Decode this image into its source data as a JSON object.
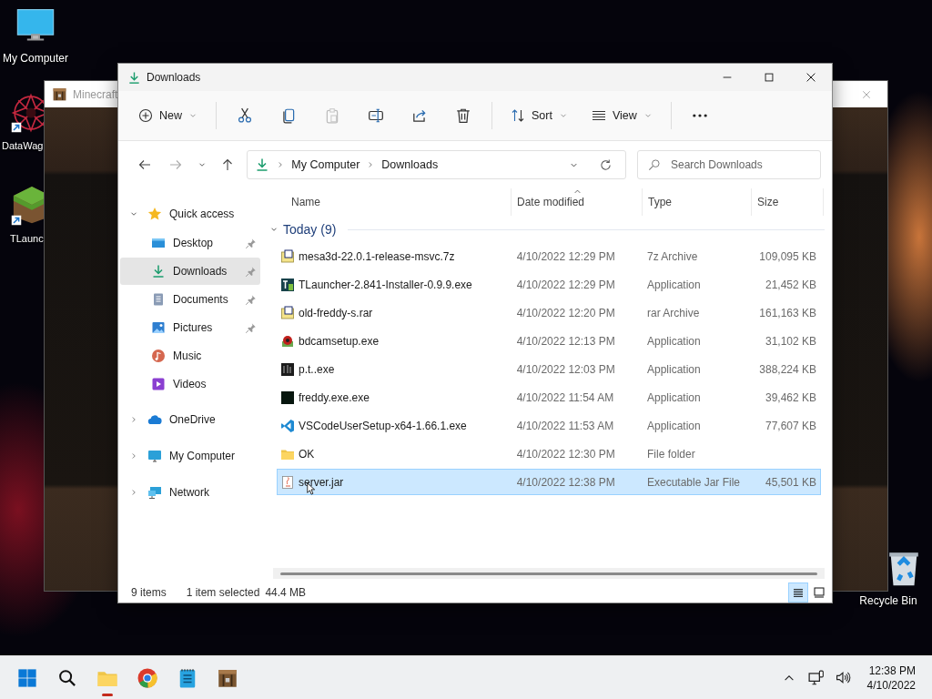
{
  "desktop_icons": [
    {
      "label": "My Computer",
      "kind": "computer",
      "shortcut": false
    },
    {
      "label": "DataWag",
      "kind": "datawag",
      "shortcut": true
    },
    {
      "label": "TLaunc",
      "kind": "grass",
      "shortcut": true
    },
    {
      "label": "Recycle Bin",
      "kind": "recycle",
      "shortcut": false
    }
  ],
  "background_window": {
    "title": "Minecraft"
  },
  "window": {
    "title": "Downloads"
  },
  "toolbar": [
    [
      {
        "kind": "new",
        "label": "New"
      }
    ],
    [
      {
        "kind": "cut",
        "disabled": false
      },
      {
        "kind": "copy",
        "disabled": false
      },
      {
        "kind": "paste",
        "disabled": true
      },
      {
        "kind": "rename",
        "disabled": false
      },
      {
        "kind": "share",
        "disabled": false
      },
      {
        "kind": "delete",
        "disabled": false
      }
    ],
    [
      {
        "kind": "sort",
        "label": "Sort"
      },
      {
        "kind": "view",
        "label": "View"
      }
    ],
    [
      {
        "kind": "more",
        "disabled": false
      }
    ]
  ],
  "navigation": {
    "back_disabled": false,
    "forward_disabled": true
  },
  "address_bar": {
    "path": [
      "My Computer",
      "Downloads"
    ]
  },
  "search": {
    "placeholder": "Search Downloads"
  },
  "sidebar": {
    "items": [
      {
        "label": "Quick access",
        "kind": "star",
        "selected": false,
        "expanded": true,
        "children": [
          {
            "label": "Desktop",
            "kind": "desktop",
            "selected": false,
            "pinned": true
          },
          {
            "label": "Downloads",
            "kind": "download",
            "selected": true,
            "pinned": true
          },
          {
            "label": "Documents",
            "kind": "document",
            "selected": false,
            "pinned": true
          },
          {
            "label": "Pictures",
            "kind": "picture",
            "selected": false,
            "pinned": true
          },
          {
            "label": "Music",
            "kind": "music",
            "selected": false,
            "pinned": false
          },
          {
            "label": "Videos",
            "kind": "video",
            "selected": false,
            "pinned": false
          }
        ]
      },
      {
        "label": "OneDrive",
        "kind": "cloud",
        "selected": false,
        "expanded": false
      },
      {
        "label": "My Computer",
        "kind": "monitor",
        "selected": false,
        "expanded": false
      },
      {
        "label": "Network",
        "kind": "network",
        "selected": false,
        "expanded": false
      }
    ]
  },
  "file_list": {
    "columns": [
      {
        "label": "Name",
        "sorted": false
      },
      {
        "label": "Date modified",
        "sorted": true
      },
      {
        "label": "Type",
        "sorted": false
      },
      {
        "label": "Size",
        "sorted": false
      }
    ],
    "groups": [
      {
        "label": "Today (9)",
        "expanded": true,
        "rows": [
          {
            "name": "mesa3d-22.0.1-release-msvc.7z",
            "kind": "archive",
            "date": "4/10/2022 12:29 PM",
            "type": "7z Archive",
            "size": "109,095 KB",
            "selected": false
          },
          {
            "name": "TLauncher-2.841-Installer-0.9.9.exe",
            "kind": "app-teal",
            "date": "4/10/2022 12:29 PM",
            "type": "Application",
            "size": "21,452 KB",
            "selected": false
          },
          {
            "name": "old-freddy-s.rar",
            "kind": "archive",
            "date": "4/10/2022 12:20 PM",
            "type": "rar Archive",
            "size": "161,163 KB",
            "selected": false
          },
          {
            "name": "bdcamsetup.exe",
            "kind": "app-red",
            "date": "4/10/2022 12:13 PM",
            "type": "Application",
            "size": "31,102 KB",
            "selected": false
          },
          {
            "name": "p.t..exe",
            "kind": "app-dark",
            "date": "4/10/2022 12:03 PM",
            "type": "Application",
            "size": "388,224 KB",
            "selected": false
          },
          {
            "name": "freddy.exe.exe",
            "kind": "app-black",
            "date": "4/10/2022 11:54 AM",
            "type": "Application",
            "size": "39,462 KB",
            "selected": false
          },
          {
            "name": "VSCodeUserSetup-x64-1.66.1.exe",
            "kind": "vscode",
            "date": "4/10/2022 11:53 AM",
            "type": "Application",
            "size": "77,607 KB",
            "selected": false
          },
          {
            "name": "OK",
            "kind": "folder",
            "date": "4/10/2022 12:30 PM",
            "type": "File folder",
            "selected": false
          },
          {
            "name": "server.jar",
            "kind": "jar",
            "date": "4/10/2022 12:38 PM",
            "type": "Executable Jar File",
            "size": "45,501 KB",
            "selected": true
          }
        ]
      }
    ]
  },
  "status_bar": {
    "item_count": "9 items",
    "selection": "1 item selected",
    "selection_size": "44.4 MB"
  },
  "view_buttons": [
    {
      "kind": "details",
      "selected": true
    },
    {
      "kind": "tiles",
      "selected": false
    }
  ],
  "taskbar": {
    "apps": [
      {
        "kind": "start",
        "running": false
      },
      {
        "kind": "search",
        "running": false
      },
      {
        "kind": "folder",
        "running": true
      },
      {
        "kind": "browser",
        "running": false
      },
      {
        "kind": "notepad",
        "running": false
      },
      {
        "kind": "crate",
        "running": false
      }
    ],
    "time": "12:38 PM",
    "date": "4/10/2022"
  }
}
